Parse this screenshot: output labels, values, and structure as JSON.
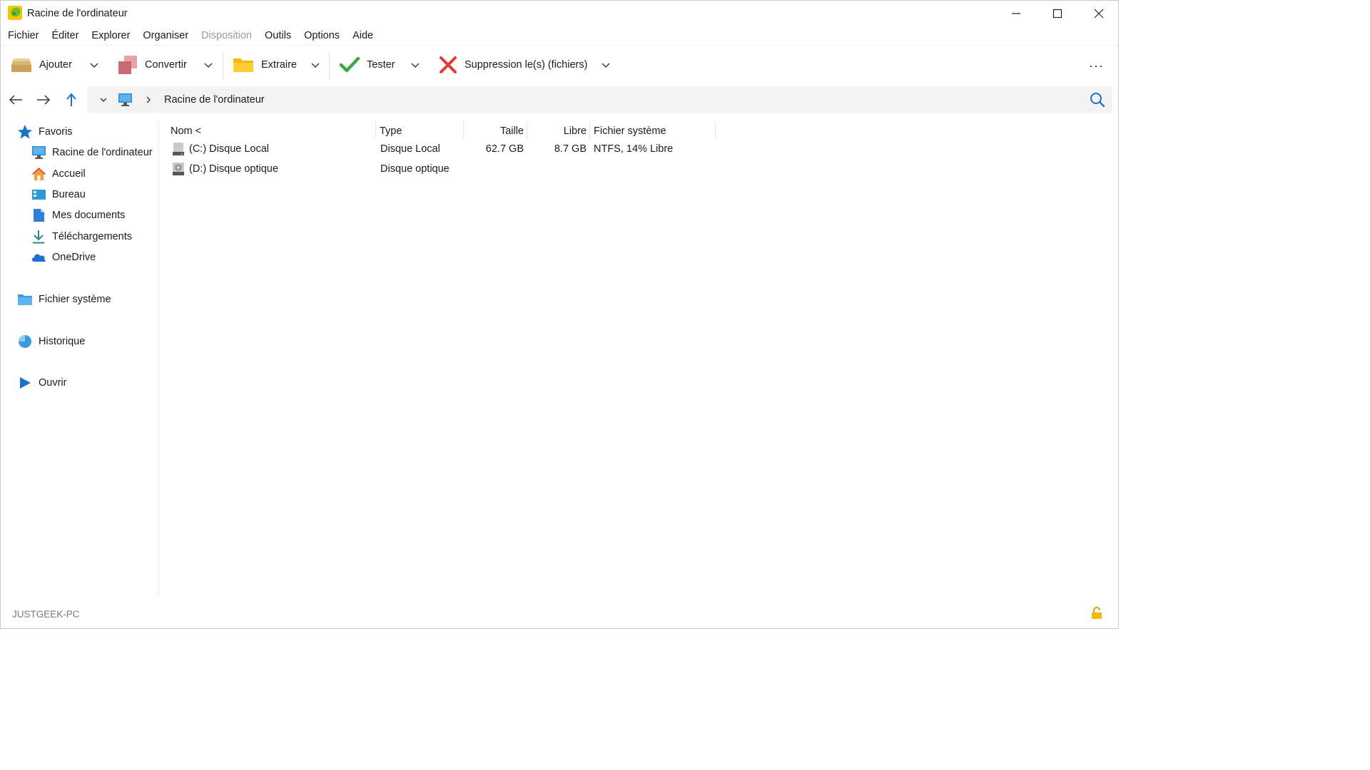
{
  "window": {
    "title": "Racine de l'ordinateur"
  },
  "menu": [
    {
      "label": "Fichier",
      "disabled": false
    },
    {
      "label": "Éditer",
      "disabled": false
    },
    {
      "label": "Explorer",
      "disabled": false
    },
    {
      "label": "Organiser",
      "disabled": false
    },
    {
      "label": "Disposition",
      "disabled": true
    },
    {
      "label": "Outils",
      "disabled": false
    },
    {
      "label": "Options",
      "disabled": false
    },
    {
      "label": "Aide",
      "disabled": false
    }
  ],
  "toolbar": {
    "add_label": "Ajouter",
    "convert_label": "Convertir",
    "extract_label": "Extraire",
    "test_label": "Tester",
    "delete_label": "Suppression le(s) (fichiers)",
    "more_label": "···"
  },
  "address": {
    "path": "Racine de l'ordinateur"
  },
  "sidebar": {
    "favorites_label": "Favoris",
    "items": [
      {
        "label": "Racine de l'ordinateur",
        "icon": "computer-icon"
      },
      {
        "label": "Accueil",
        "icon": "home-icon"
      },
      {
        "label": "Bureau",
        "icon": "desktop-icon"
      },
      {
        "label": "Mes documents",
        "icon": "documents-icon"
      },
      {
        "label": "Téléchargements",
        "icon": "download-icon"
      },
      {
        "label": "OneDrive",
        "icon": "cloud-icon"
      }
    ],
    "filesystem_label": "Fichier système",
    "history_label": "Historique",
    "open_label": "Ouvrir"
  },
  "columns": {
    "name": "Nom <",
    "type": "Type",
    "size": "Taille",
    "free": "Libre",
    "fs": "Fichier système"
  },
  "rows": [
    {
      "name": "(C:) Disque Local",
      "type": "Disque Local",
      "size": "62.7 GB",
      "free": "8.7 GB",
      "fs": "NTFS, 14% Libre",
      "icon": "hard-drive-icon"
    },
    {
      "name": "(D:) Disque optique",
      "type": "Disque optique",
      "size": "",
      "free": "",
      "fs": "",
      "icon": "optical-drive-icon"
    }
  ],
  "status": {
    "computer_name": "JUSTGEEK-PC"
  },
  "colors": {
    "accent": "#1a73c8",
    "green": "#3aa845",
    "red": "#e03c31",
    "folder": "#f5b800"
  }
}
